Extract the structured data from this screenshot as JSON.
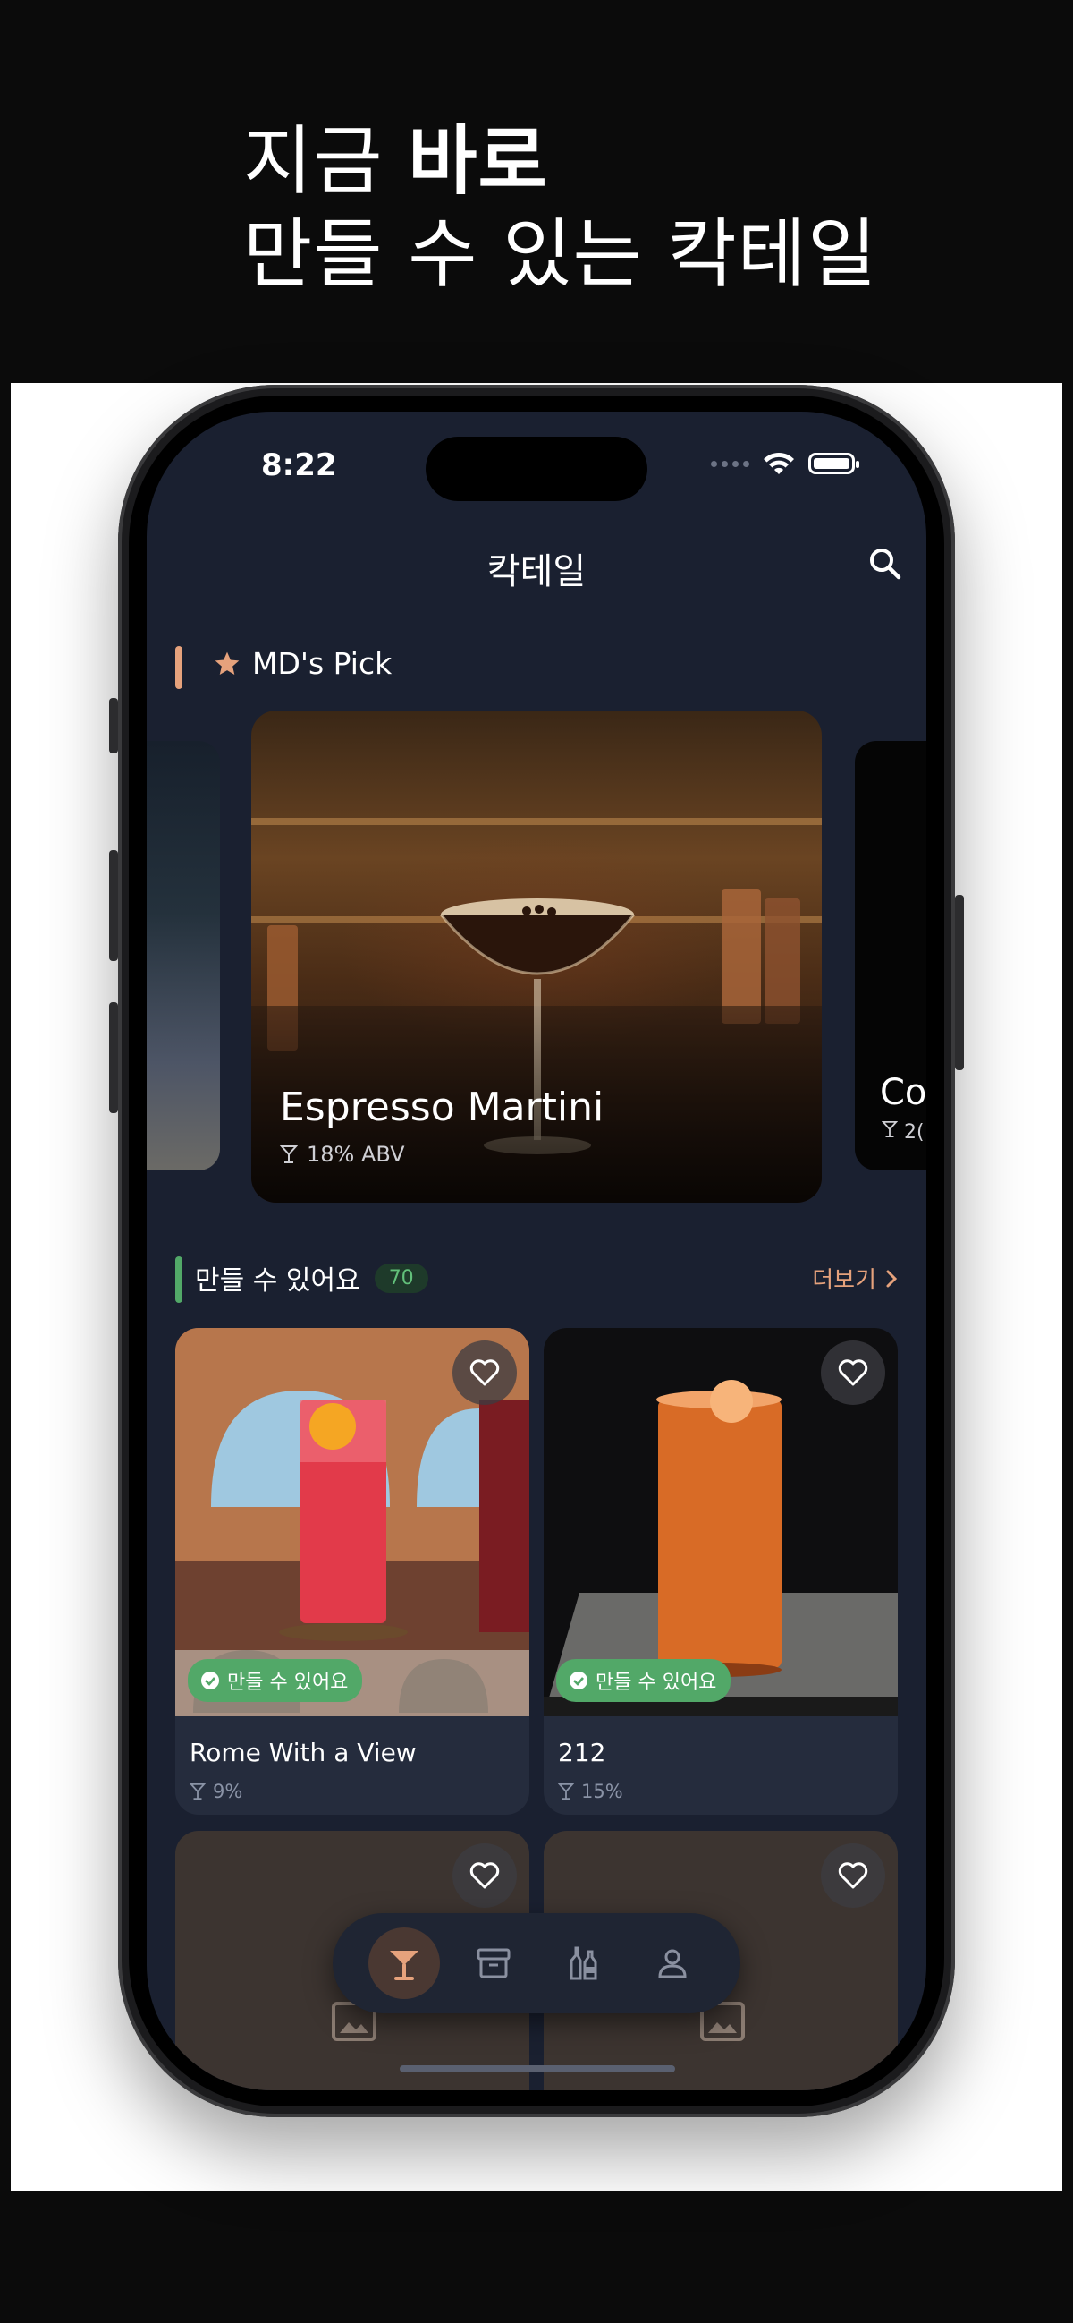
{
  "promo": {
    "headline_line1_prefix": "지금",
    "headline_line1_bold": "바로",
    "headline_line2": "만들 수 있는 칵테일"
  },
  "status_bar": {
    "time": "8:22"
  },
  "nav": {
    "title": "칵테일",
    "search_icon": "search-icon"
  },
  "md_pick": {
    "label": "MD's Pick",
    "featured": {
      "name": "Espresso Martini",
      "abv": "18% ABV"
    },
    "next_peek": {
      "name": "Co",
      "abv": "2("
    }
  },
  "available": {
    "title": "만들 수 있어요",
    "count": "70",
    "more_label": "더보기",
    "cards": [
      {
        "name": "Rome With a View",
        "abv": "9%",
        "badge": "만들 수 있어요"
      },
      {
        "name": "212",
        "abv": "15%",
        "badge": "만들 수 있어요"
      }
    ]
  },
  "tabbar": {
    "items": [
      {
        "icon": "cocktail-glass-icon",
        "active": true
      },
      {
        "icon": "archive-box-icon",
        "active": false
      },
      {
        "icon": "bottles-icon",
        "active": false
      },
      {
        "icon": "person-icon",
        "active": false
      }
    ]
  },
  "colors": {
    "accent": "#e6a27c",
    "available_green": "#52a868",
    "screen_bg": "#1a2030"
  }
}
